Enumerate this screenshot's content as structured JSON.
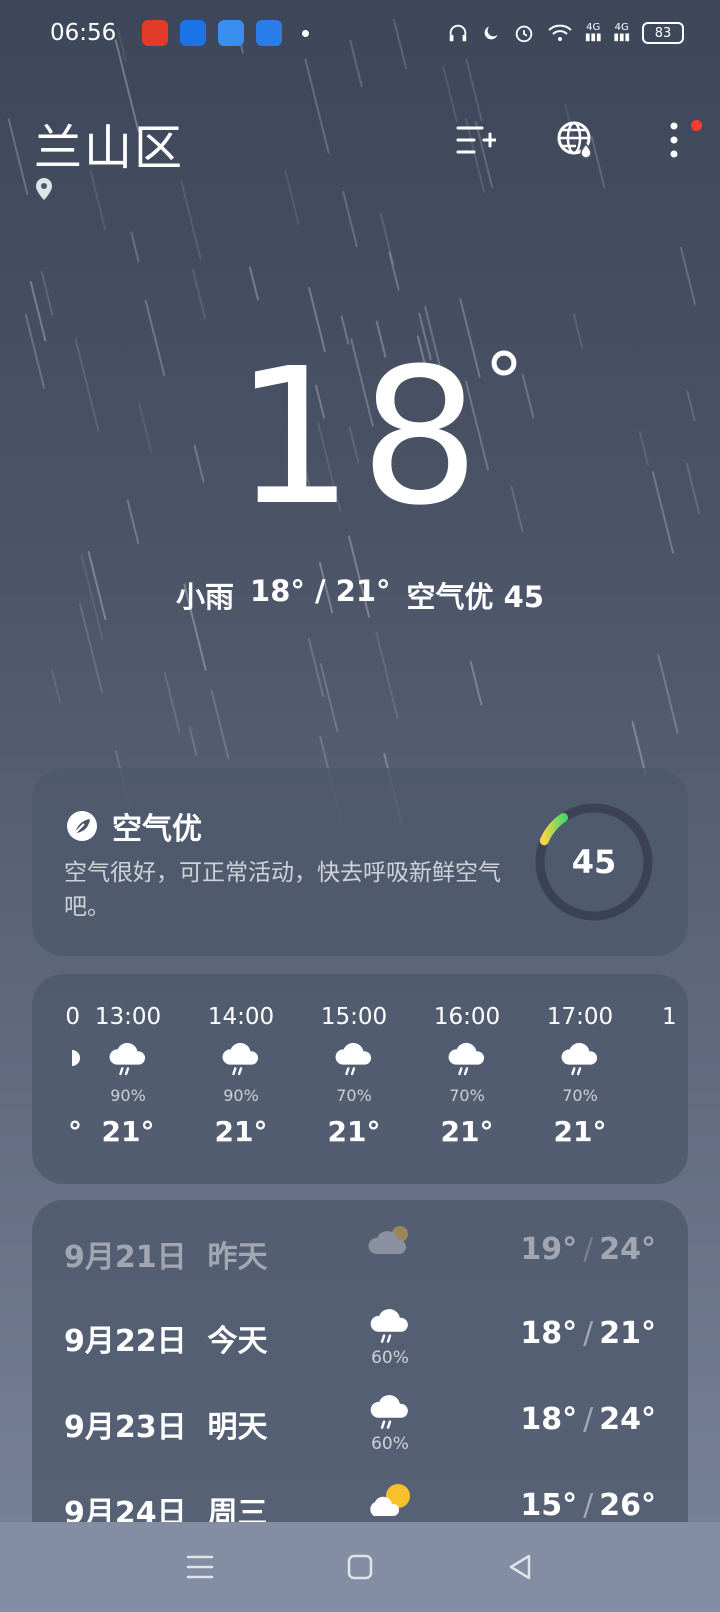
{
  "status_bar": {
    "time": "06:56",
    "network_label_1": "4G",
    "network_label_2": "4G",
    "battery": "83",
    "app_icons": [
      "app-icon-red",
      "app-icon-blue-doc",
      "app-icon-weather",
      "app-icon-blue-leaf"
    ]
  },
  "header": {
    "city": "兰山区"
  },
  "current": {
    "temperature": "18",
    "degree": "°",
    "condition": "小雨",
    "range": "18° / 21°",
    "air": "空气优 45"
  },
  "aqi": {
    "title": "空气优",
    "description": "空气很好，可正常活动，快去呼吸新鲜空气吧。",
    "value": "45",
    "level_fraction": 0.09,
    "accent_colors": [
      "#f5d547",
      "#4cd964"
    ]
  },
  "hourly": {
    "partial_left": {
      "time": "0",
      "temp": "°"
    },
    "items": [
      {
        "time": "13:00",
        "precip": "90%",
        "temp": "21°"
      },
      {
        "time": "14:00",
        "precip": "90%",
        "temp": "21°"
      },
      {
        "time": "15:00",
        "precip": "70%",
        "temp": "21°"
      },
      {
        "time": "16:00",
        "precip": "70%",
        "temp": "21°"
      },
      {
        "time": "17:00",
        "precip": "70%",
        "temp": "21°"
      }
    ],
    "partial_right": {
      "time": "1"
    }
  },
  "daily": [
    {
      "date": "9月21日",
      "label": "昨天",
      "icon": "cloudy-sun-icon",
      "precip": "",
      "low": "19°",
      "high": "24°"
    },
    {
      "date": "9月22日",
      "label": "今天",
      "icon": "rain-cloud-icon",
      "precip": "60%",
      "low": "18°",
      "high": "21°"
    },
    {
      "date": "9月23日",
      "label": "明天",
      "icon": "rain-cloud-icon",
      "precip": "60%",
      "low": "18°",
      "high": "24°"
    },
    {
      "date": "9月24日",
      "label": "周三",
      "icon": "sun-cloud-icon",
      "precip": "",
      "low": "15°",
      "high": "26°"
    }
  ]
}
